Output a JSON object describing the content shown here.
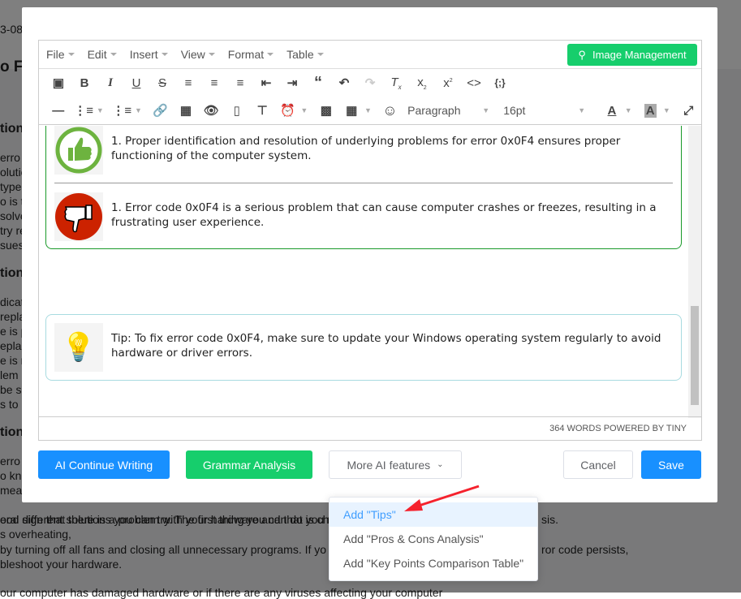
{
  "background": {
    "fragments": [
      "3-08",
      "o F",
      "tion",
      "erro",
      "olutic",
      "type",
      "o is tr",
      "solve",
      "try re",
      "sues",
      "tion",
      "dicate",
      "repla",
      "e is p",
      "eplac",
      "e is n",
      "lem",
      "be se",
      "s to c",
      "tion",
      "erro",
      "o kno",
      "mea"
    ],
    "lines": [
      "eral different solutions you can try. The first thing you can do is che",
      "ood sign that there is a problem with your hardware and that you n",
      "sis.",
      "s overheating,",
      "by turning off all fans and closing all unnecessary programs. If yo",
      "ror code persists,",
      "bleshoot your hardware.",
      "our computer has damaged hardware or if there are any viruses affecting your computer"
    ]
  },
  "editor": {
    "menu": [
      "File",
      "Edit",
      "Insert",
      "View",
      "Format",
      "Table"
    ],
    "image_management": "Image Management",
    "block_format": "Paragraph",
    "font_size": "16pt",
    "pros": "1. Proper identification and resolution of underlying problems for error 0x0F4 ensures proper functioning of the computer system.",
    "cons": "1. Error code 0x0F4 is a serious problem that can cause computer crashes or freezes, resulting in a frustrating user experience.",
    "tip": "Tip: To fix error code 0x0F4, make sure to update your Windows operating system regularly to avoid hardware or driver errors.",
    "status": "364 WORDS POWERED BY TINY"
  },
  "buttons": {
    "ai_continue": "AI Continue Writing",
    "grammar": "Grammar Analysis",
    "more": "More AI features",
    "cancel": "Cancel",
    "save": "Save"
  },
  "dropdown": [
    "Add \"Tips\"",
    "Add \"Pros & Cons Analysis\"",
    "Add \"Key Points Comparison Table\""
  ],
  "colors": {
    "primary": "#1890ff",
    "green": "#16ce6c",
    "active": "#409eff",
    "arrow": "#f5222d"
  }
}
